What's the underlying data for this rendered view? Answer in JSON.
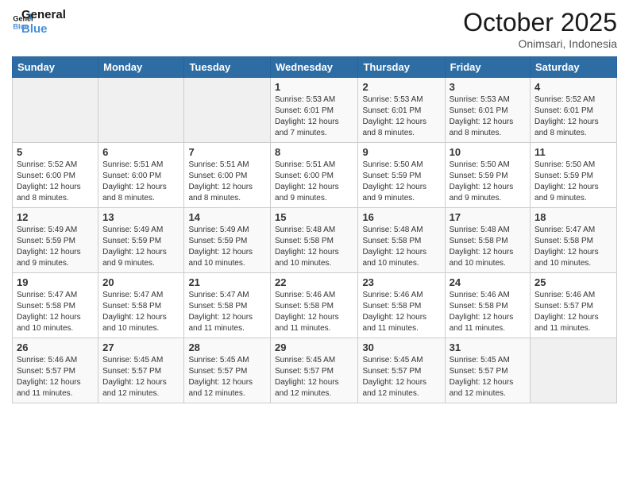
{
  "header": {
    "logo_general": "General",
    "logo_blue": "Blue",
    "month_title": "October 2025",
    "location": "Onimsari, Indonesia"
  },
  "days_of_week": [
    "Sunday",
    "Monday",
    "Tuesday",
    "Wednesday",
    "Thursday",
    "Friday",
    "Saturday"
  ],
  "weeks": [
    [
      {
        "day": "",
        "info": ""
      },
      {
        "day": "",
        "info": ""
      },
      {
        "day": "",
        "info": ""
      },
      {
        "day": "1",
        "info": "Sunrise: 5:53 AM\nSunset: 6:01 PM\nDaylight: 12 hours\nand 7 minutes."
      },
      {
        "day": "2",
        "info": "Sunrise: 5:53 AM\nSunset: 6:01 PM\nDaylight: 12 hours\nand 8 minutes."
      },
      {
        "day": "3",
        "info": "Sunrise: 5:53 AM\nSunset: 6:01 PM\nDaylight: 12 hours\nand 8 minutes."
      },
      {
        "day": "4",
        "info": "Sunrise: 5:52 AM\nSunset: 6:01 PM\nDaylight: 12 hours\nand 8 minutes."
      }
    ],
    [
      {
        "day": "5",
        "info": "Sunrise: 5:52 AM\nSunset: 6:00 PM\nDaylight: 12 hours\nand 8 minutes."
      },
      {
        "day": "6",
        "info": "Sunrise: 5:51 AM\nSunset: 6:00 PM\nDaylight: 12 hours\nand 8 minutes."
      },
      {
        "day": "7",
        "info": "Sunrise: 5:51 AM\nSunset: 6:00 PM\nDaylight: 12 hours\nand 8 minutes."
      },
      {
        "day": "8",
        "info": "Sunrise: 5:51 AM\nSunset: 6:00 PM\nDaylight: 12 hours\nand 9 minutes."
      },
      {
        "day": "9",
        "info": "Sunrise: 5:50 AM\nSunset: 5:59 PM\nDaylight: 12 hours\nand 9 minutes."
      },
      {
        "day": "10",
        "info": "Sunrise: 5:50 AM\nSunset: 5:59 PM\nDaylight: 12 hours\nand 9 minutes."
      },
      {
        "day": "11",
        "info": "Sunrise: 5:50 AM\nSunset: 5:59 PM\nDaylight: 12 hours\nand 9 minutes."
      }
    ],
    [
      {
        "day": "12",
        "info": "Sunrise: 5:49 AM\nSunset: 5:59 PM\nDaylight: 12 hours\nand 9 minutes."
      },
      {
        "day": "13",
        "info": "Sunrise: 5:49 AM\nSunset: 5:59 PM\nDaylight: 12 hours\nand 9 minutes."
      },
      {
        "day": "14",
        "info": "Sunrise: 5:49 AM\nSunset: 5:59 PM\nDaylight: 12 hours\nand 10 minutes."
      },
      {
        "day": "15",
        "info": "Sunrise: 5:48 AM\nSunset: 5:58 PM\nDaylight: 12 hours\nand 10 minutes."
      },
      {
        "day": "16",
        "info": "Sunrise: 5:48 AM\nSunset: 5:58 PM\nDaylight: 12 hours\nand 10 minutes."
      },
      {
        "day": "17",
        "info": "Sunrise: 5:48 AM\nSunset: 5:58 PM\nDaylight: 12 hours\nand 10 minutes."
      },
      {
        "day": "18",
        "info": "Sunrise: 5:47 AM\nSunset: 5:58 PM\nDaylight: 12 hours\nand 10 minutes."
      }
    ],
    [
      {
        "day": "19",
        "info": "Sunrise: 5:47 AM\nSunset: 5:58 PM\nDaylight: 12 hours\nand 10 minutes."
      },
      {
        "day": "20",
        "info": "Sunrise: 5:47 AM\nSunset: 5:58 PM\nDaylight: 12 hours\nand 10 minutes."
      },
      {
        "day": "21",
        "info": "Sunrise: 5:47 AM\nSunset: 5:58 PM\nDaylight: 12 hours\nand 11 minutes."
      },
      {
        "day": "22",
        "info": "Sunrise: 5:46 AM\nSunset: 5:58 PM\nDaylight: 12 hours\nand 11 minutes."
      },
      {
        "day": "23",
        "info": "Sunrise: 5:46 AM\nSunset: 5:58 PM\nDaylight: 12 hours\nand 11 minutes."
      },
      {
        "day": "24",
        "info": "Sunrise: 5:46 AM\nSunset: 5:58 PM\nDaylight: 12 hours\nand 11 minutes."
      },
      {
        "day": "25",
        "info": "Sunrise: 5:46 AM\nSunset: 5:57 PM\nDaylight: 12 hours\nand 11 minutes."
      }
    ],
    [
      {
        "day": "26",
        "info": "Sunrise: 5:46 AM\nSunset: 5:57 PM\nDaylight: 12 hours\nand 11 minutes."
      },
      {
        "day": "27",
        "info": "Sunrise: 5:45 AM\nSunset: 5:57 PM\nDaylight: 12 hours\nand 12 minutes."
      },
      {
        "day": "28",
        "info": "Sunrise: 5:45 AM\nSunset: 5:57 PM\nDaylight: 12 hours\nand 12 minutes."
      },
      {
        "day": "29",
        "info": "Sunrise: 5:45 AM\nSunset: 5:57 PM\nDaylight: 12 hours\nand 12 minutes."
      },
      {
        "day": "30",
        "info": "Sunrise: 5:45 AM\nSunset: 5:57 PM\nDaylight: 12 hours\nand 12 minutes."
      },
      {
        "day": "31",
        "info": "Sunrise: 5:45 AM\nSunset: 5:57 PM\nDaylight: 12 hours\nand 12 minutes."
      },
      {
        "day": "",
        "info": ""
      }
    ]
  ]
}
